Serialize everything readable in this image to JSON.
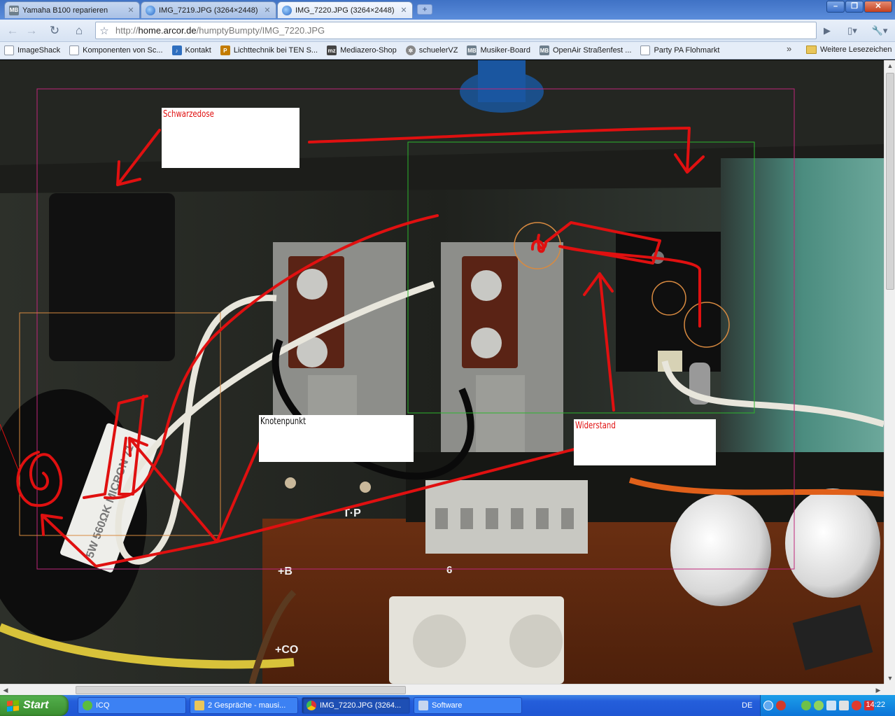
{
  "browser": {
    "tabs": [
      {
        "title": "Yamaha B100 reparieren",
        "icon": "mb-icon",
        "active": false
      },
      {
        "title": "IMG_7219.JPG (3264×2448)",
        "icon": "globe-icon",
        "active": false
      },
      {
        "title": "IMG_7220.JPG (3264×2448)",
        "icon": "globe-icon",
        "active": true
      }
    ],
    "new_tab_label": "+",
    "window_buttons": {
      "minimize": "–",
      "maximize": "❐",
      "close": "✕"
    },
    "toolbar": {
      "back_icon": "←",
      "forward_icon": "→",
      "reload_icon": "↻",
      "home_icon": "⌂",
      "bookmark_star": "☆",
      "url_prefix": "http://",
      "url_host": "home.arcor.de",
      "url_path": "/humptyBumpty/IMG_7220.JPG",
      "go_icon": "▶",
      "page_menu_icon": "▯▾",
      "tools_menu_icon": "🔧▾"
    },
    "bookmarks": [
      {
        "label": "ImageShack",
        "icon": "page"
      },
      {
        "label": "Komponenten von Sc...",
        "icon": "page"
      },
      {
        "label": "Kontakt",
        "icon": "note"
      },
      {
        "label": "Lichttechnik bei TEN S...",
        "icon": "p"
      },
      {
        "label": "Mediazero-Shop",
        "icon": "mz"
      },
      {
        "label": "schuelerVZ",
        "icon": "gear"
      },
      {
        "label": "Musiker-Board",
        "icon": "mb"
      },
      {
        "label": "OpenAir Straßenfest ...",
        "icon": "mb"
      },
      {
        "label": "Party PA Flohmarkt",
        "icon": "page"
      }
    ],
    "bookmarks_overflow": "»",
    "other_bookmarks": "Weitere Lesezeichen"
  },
  "image_annotations": {
    "schwarzedose": "Schwarzedose",
    "knotenpunkt": "Knotenpunkt",
    "widerstand": "Widerstand"
  },
  "photo_text": {
    "tp_label": "T·P",
    "plus_b": "+B",
    "plus_co": "+CO",
    "resistor_text": "5W 560ΩK MICRON 71",
    "connector_num": "6"
  },
  "taskbar": {
    "start_label": "Start",
    "items": [
      {
        "label": "ICQ",
        "active": false
      },
      {
        "label": "2 Gespräche - mausi...",
        "active": false
      },
      {
        "label": "IMG_7220.JPG (3264...",
        "active": true
      },
      {
        "label": "Software",
        "active": false
      }
    ],
    "language": "DE",
    "clock": "14:22"
  },
  "colors": {
    "annotation_red": "#e01010",
    "outer_frame": "#c0267a",
    "green_frame": "#2db52d",
    "orange_frame": "#d88a40",
    "taskbar_blue": "#245edb",
    "start_green": "#3a8d2e"
  }
}
